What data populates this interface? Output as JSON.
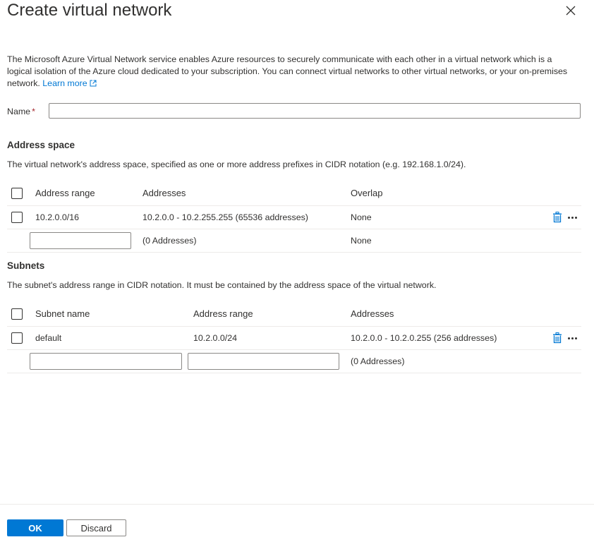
{
  "panel": {
    "title": "Create virtual network",
    "description": "The Microsoft Azure Virtual Network service enables Azure resources to securely communicate with each other in a virtual network which is a logical isolation of the Azure cloud dedicated to your subscription. You can connect virtual networks to other virtual networks, or your on-premises network.",
    "learn_more": "Learn more"
  },
  "name_field": {
    "label": "Name",
    "required_marker": "*",
    "value": ""
  },
  "address_space": {
    "title": "Address space",
    "description": "The virtual network's address space, specified as one or more address prefixes in CIDR notation (e.g. 192.168.1.0/24).",
    "columns": [
      "Address range",
      "Addresses",
      "Overlap"
    ],
    "rows": [
      {
        "range": "10.2.0.0/16",
        "addresses": "10.2.0.0 - 10.2.255.255 (65536 addresses)",
        "overlap": "None"
      }
    ],
    "new_row": {
      "range": "",
      "addresses": "(0 Addresses)",
      "overlap": "None"
    }
  },
  "subnets": {
    "title": "Subnets",
    "description": "The subnet's address range in CIDR notation. It must be contained by the address space of the virtual network.",
    "columns": [
      "Subnet name",
      "Address range",
      "Addresses"
    ],
    "rows": [
      {
        "name": "default",
        "range": "10.2.0.0/24",
        "addresses": "10.2.0.0 - 10.2.0.255 (256 addresses)"
      }
    ],
    "new_row": {
      "name": "",
      "range": "",
      "addresses": "(0 Addresses)"
    }
  },
  "footer": {
    "ok_label": "OK",
    "discard_label": "Discard"
  },
  "colors": {
    "accent": "#0078d4",
    "required": "#a4262c",
    "text": "#323130"
  },
  "icons": {
    "close": "close-icon",
    "external_link": "external-link-icon",
    "delete": "trash-icon",
    "more": "more-icon"
  }
}
